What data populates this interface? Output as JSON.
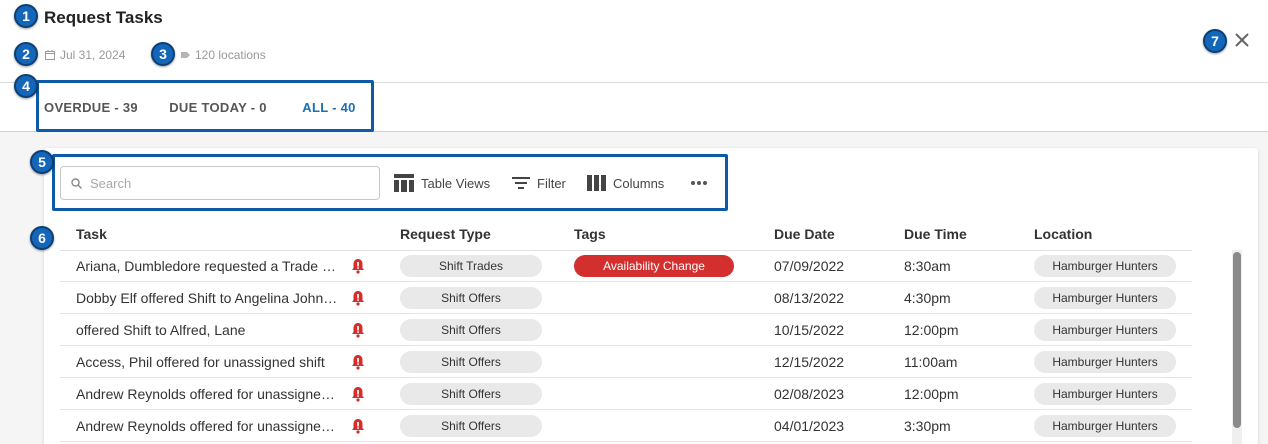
{
  "header": {
    "title": "Request Tasks",
    "date": "Jul 31, 2024",
    "locations": "120 locations"
  },
  "tabs": [
    {
      "label": "OVERDUE - 39",
      "active": false
    },
    {
      "label": "DUE TODAY - 0",
      "active": false
    },
    {
      "label": "ALL - 40",
      "active": true
    }
  ],
  "toolbar": {
    "search_placeholder": "Search",
    "table_views": "Table Views",
    "filter": "Filter",
    "columns": "Columns"
  },
  "table": {
    "columns": [
      "Task",
      "Request Type",
      "Tags",
      "Due Date",
      "Due Time",
      "Location"
    ],
    "rows": [
      {
        "task": "Ariana, Dumbledore requested a Trade with Ron",
        "type": "Shift Trades",
        "tag": "Availability Change",
        "date": "07/09/2022",
        "time": "8:30am",
        "location": "Hamburger Hunters"
      },
      {
        "task": "Dobby Elf offered Shift to Angelina Johnson",
        "type": "Shift Offers",
        "tag": "",
        "date": "08/13/2022",
        "time": "4:30pm",
        "location": "Hamburger Hunters"
      },
      {
        "task": "offered Shift to Alfred, Lane",
        "type": "Shift Offers",
        "tag": "",
        "date": "10/15/2022",
        "time": "12:00pm",
        "location": "Hamburger Hunters"
      },
      {
        "task": "Access, Phil offered for unassigned shift",
        "type": "Shift Offers",
        "tag": "",
        "date": "12/15/2022",
        "time": "11:00am",
        "location": "Hamburger Hunters"
      },
      {
        "task": "Andrew Reynolds offered for unassigned shift",
        "type": "Shift Offers",
        "tag": "",
        "date": "02/08/2023",
        "time": "12:00pm",
        "location": "Hamburger Hunters"
      },
      {
        "task": "Andrew Reynolds offered for unassigned shift",
        "type": "Shift Offers",
        "tag": "",
        "date": "04/01/2023",
        "time": "3:30pm",
        "location": "Hamburger Hunters"
      }
    ]
  },
  "annotations": [
    "1",
    "2",
    "3",
    "4",
    "5",
    "6",
    "7"
  ],
  "colors": {
    "accent": "#1a6fb0",
    "tag_red": "#d32f2f",
    "bell_red": "#d32f2f",
    "badge_blue": "#1466b8"
  }
}
